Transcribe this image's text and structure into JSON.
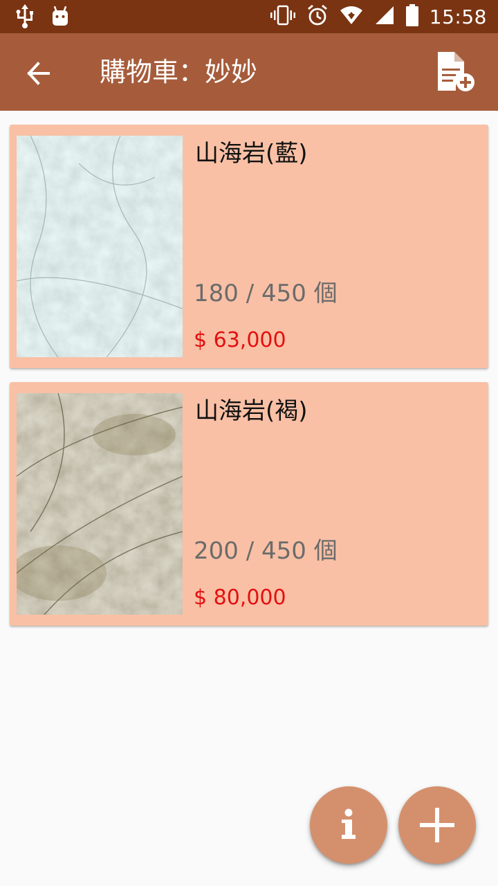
{
  "status_bar": {
    "time": "15:58",
    "left_icons": [
      "usb-icon",
      "android-debug-icon"
    ],
    "right_icons": [
      "vibrate-icon",
      "alarm-icon",
      "wifi-icon",
      "signal-icon",
      "battery-icon"
    ]
  },
  "app_bar": {
    "title": "購物車：妙妙",
    "back_icon": "arrow-left-icon",
    "action_icon": "document-add-icon"
  },
  "cart": {
    "items": [
      {
        "name": "山海岩(藍)",
        "quantity": "180 / 450 個",
        "price": "$ 63,000",
        "image": "blue-gray-slate-texture"
      },
      {
        "name": "山海岩(褐)",
        "quantity": "200 / 450 個",
        "price": "$ 80,000",
        "image": "brown-slate-texture"
      }
    ]
  },
  "fabs": [
    {
      "icon": "info-icon"
    },
    {
      "icon": "plus-icon"
    }
  ],
  "colors": {
    "status_bar": "#7a3412",
    "app_bar": "#a65c3b",
    "card_background": "#f9c0a5",
    "price_text": "#e31010",
    "fab": "#d4906d"
  }
}
